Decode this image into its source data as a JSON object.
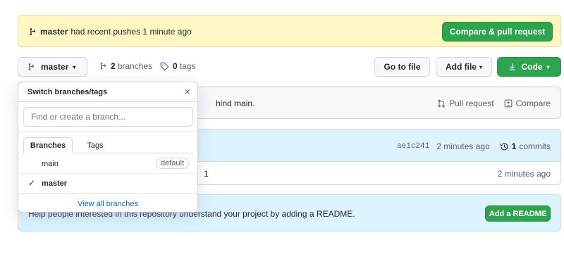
{
  "flash": {
    "branch": "master",
    "message": "had recent pushes 1 minute ago",
    "button": "Compare & pull request"
  },
  "branch_button": {
    "label": "master",
    "caret": "▾"
  },
  "branches_link": {
    "count": "2",
    "label": "branches"
  },
  "tags_link": {
    "count": "0",
    "label": "tags"
  },
  "toolbar": {
    "goto_file": "Go to file",
    "add_file": "Add file",
    "add_file_caret": "▾",
    "code": "Code",
    "code_caret": "▾"
  },
  "behind_row": {
    "text": "hind main.",
    "pull_request": "Pull request",
    "compare": "Compare"
  },
  "commit": {
    "sha": "ae1c241",
    "time": "2 minutes ago",
    "count": "1",
    "commits_label": "commits",
    "row_text": "1",
    "row_time": "2 minutes ago"
  },
  "readme": {
    "text": "Help people interested in this repository understand your project by adding a README.",
    "button": "Add a README"
  },
  "dropdown": {
    "title": "Switch branches/tags",
    "close": "×",
    "search_placeholder": "Find or create a branch...",
    "tabs": [
      "Branches",
      "Tags"
    ],
    "items": [
      {
        "name": "main",
        "badge": "default"
      },
      {
        "name": "master",
        "check": "✓"
      }
    ],
    "footer": "View all branches"
  },
  "colors": {
    "green": "#2da44e",
    "flash_bg": "#fff8c5",
    "info_bg": "#ddf4ff",
    "link": "#0969da"
  }
}
